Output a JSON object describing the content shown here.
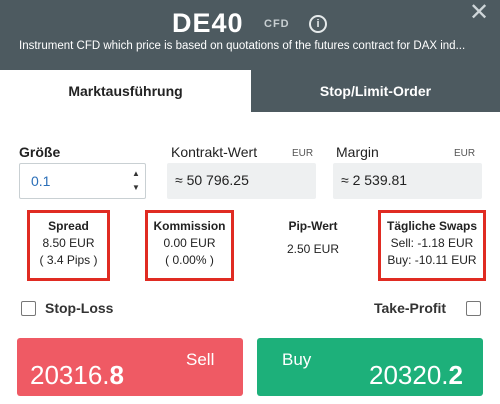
{
  "header": {
    "symbol": "DE40",
    "type_tag": "CFD",
    "description": "Instrument CFD which price is based on quotations of the futures contract for DAX ind..."
  },
  "tabs": [
    {
      "label": "Marktausführung",
      "active": true
    },
    {
      "label": "Stop/Limit-Order",
      "active": false
    }
  ],
  "size": {
    "label": "Größe",
    "value": "0.1"
  },
  "contract_value": {
    "label": "Kontrakt-Wert",
    "unit": "EUR",
    "value": "≈ 50 796.25"
  },
  "margin": {
    "label": "Margin",
    "unit": "EUR",
    "value": "≈ 2 539.81"
  },
  "spread": {
    "title": "Spread",
    "value": "8.50 EUR",
    "pips": "( 3.4 Pips )"
  },
  "commission": {
    "title": "Kommission",
    "value": "0.00 EUR",
    "percent": "( 0.00% )"
  },
  "pip_value": {
    "title": "Pip-Wert",
    "value": "2.50 EUR"
  },
  "swaps": {
    "title": "Tägliche Swaps",
    "sell": "Sell: -1.18 EUR",
    "buy": "Buy: -10.11 EUR"
  },
  "options": {
    "stop_loss": "Stop-Loss",
    "take_profit": "Take-Profit"
  },
  "sell": {
    "label": "Sell",
    "price_main": "20316.",
    "price_last": "8"
  },
  "buy": {
    "label": "Buy",
    "price_main": "20320.",
    "price_last": "2"
  },
  "colors": {
    "header_bg": "#4d5a60",
    "sell": "#ef5a64",
    "buy": "#1db07a",
    "highlight": "#e02b22",
    "input_text": "#2b6fb8"
  }
}
